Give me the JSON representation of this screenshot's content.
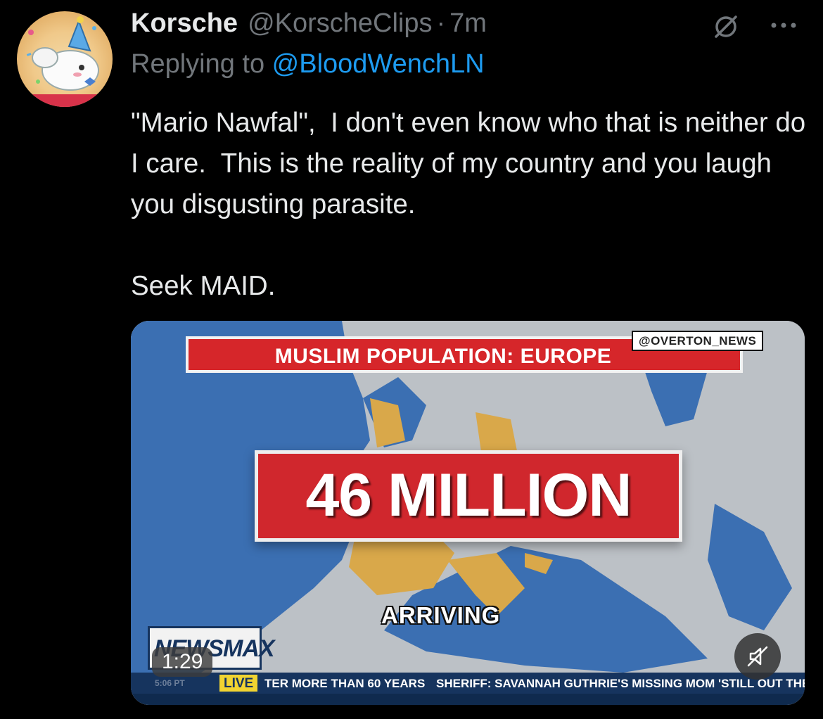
{
  "tweet": {
    "display_name": "Korsche",
    "handle": "@KorscheClips",
    "separator": "·",
    "time": "7m",
    "replying_prefix": "Replying to ",
    "replying_to": "@BloodWenchLN",
    "text": "\"Mario Nawfal\",  I don't even know who that is neither do I care.  This is the reality of my country and you laugh you disgusting parasite.\n\nSeek MAID.",
    "icons": {
      "muted": "muted-slash-icon",
      "more": "more-dots-icon"
    }
  },
  "media": {
    "type": "video",
    "duration": "1:29",
    "banner_title": "MUSLIM POPULATION: EUROPE",
    "watermark": "@OVERTON_NEWS",
    "headline": "46 MILLION",
    "subheadline": "ARRIVING",
    "network_logo": "NEWSMAX",
    "ticker": {
      "time": "5:06 PT",
      "live": "LIVE",
      "text_1": "TER MORE THAN 60 YEARS",
      "text_2": "SHERIFF: SAVANNAH GUTHRIE'S MISSING MOM 'STILL OUT THE"
    },
    "mute_icon": "speaker-muted-icon"
  },
  "colors": {
    "background": "#000000",
    "text_primary": "#e7e9ea",
    "text_secondary": "#71767b",
    "link": "#1d9bf0",
    "newsmax_red": "#d0272d",
    "newsmax_navy": "#16345e"
  }
}
